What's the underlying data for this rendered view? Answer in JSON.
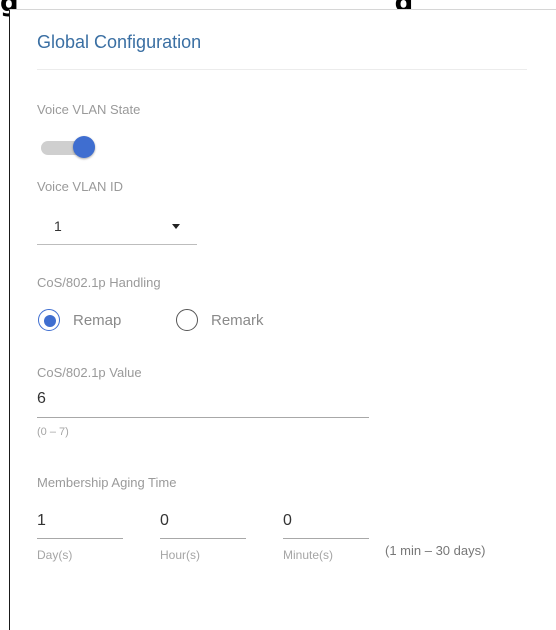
{
  "page": {
    "heading_partial": "g...                              ...g"
  },
  "panel": {
    "title": "Global Configuration"
  },
  "voice_vlan_state": {
    "label": "Voice VLAN State",
    "enabled": true
  },
  "voice_vlan_id": {
    "label": "Voice VLAN ID",
    "value": "1"
  },
  "cos_handling": {
    "label": "CoS/802.1p Handling",
    "options": [
      {
        "label": "Remap",
        "selected": true
      },
      {
        "label": "Remark",
        "selected": false
      }
    ]
  },
  "cos_value": {
    "label": "CoS/802.1p Value",
    "value": "6",
    "hint": "(0 – 7)"
  },
  "aging_time": {
    "label": "Membership Aging Time",
    "days": {
      "value": "1",
      "unit": "Day(s)"
    },
    "hours": {
      "value": "0",
      "unit": "Hour(s)"
    },
    "minutes": {
      "value": "0",
      "unit": "Minute(s)"
    },
    "range": "(1 min – 30 days)"
  },
  "colors": {
    "accent": "#3f6ed0",
    "title": "#3a6fa3",
    "label": "#9a9a9a"
  }
}
